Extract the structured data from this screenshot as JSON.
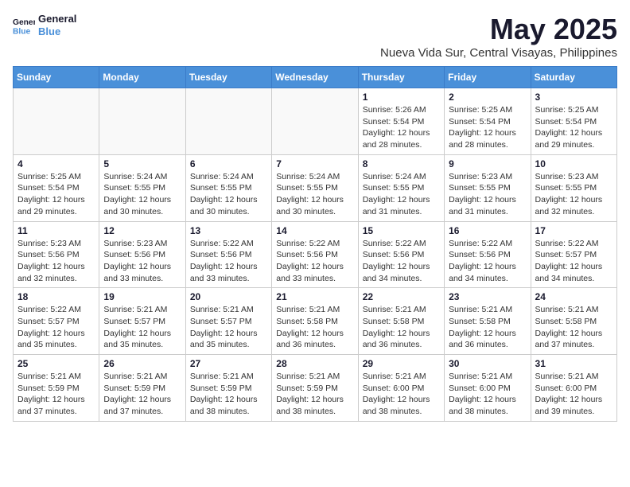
{
  "logo": {
    "line1": "General",
    "line2": "Blue"
  },
  "title": "May 2025",
  "subtitle": "Nueva Vida Sur, Central Visayas, Philippines",
  "weekdays": [
    "Sunday",
    "Monday",
    "Tuesday",
    "Wednesday",
    "Thursday",
    "Friday",
    "Saturday"
  ],
  "weeks": [
    [
      {
        "day": "",
        "info": ""
      },
      {
        "day": "",
        "info": ""
      },
      {
        "day": "",
        "info": ""
      },
      {
        "day": "",
        "info": ""
      },
      {
        "day": "1",
        "info": "Sunrise: 5:26 AM\nSunset: 5:54 PM\nDaylight: 12 hours\nand 28 minutes."
      },
      {
        "day": "2",
        "info": "Sunrise: 5:25 AM\nSunset: 5:54 PM\nDaylight: 12 hours\nand 28 minutes."
      },
      {
        "day": "3",
        "info": "Sunrise: 5:25 AM\nSunset: 5:54 PM\nDaylight: 12 hours\nand 29 minutes."
      }
    ],
    [
      {
        "day": "4",
        "info": "Sunrise: 5:25 AM\nSunset: 5:54 PM\nDaylight: 12 hours\nand 29 minutes."
      },
      {
        "day": "5",
        "info": "Sunrise: 5:24 AM\nSunset: 5:55 PM\nDaylight: 12 hours\nand 30 minutes."
      },
      {
        "day": "6",
        "info": "Sunrise: 5:24 AM\nSunset: 5:55 PM\nDaylight: 12 hours\nand 30 minutes."
      },
      {
        "day": "7",
        "info": "Sunrise: 5:24 AM\nSunset: 5:55 PM\nDaylight: 12 hours\nand 30 minutes."
      },
      {
        "day": "8",
        "info": "Sunrise: 5:24 AM\nSunset: 5:55 PM\nDaylight: 12 hours\nand 31 minutes."
      },
      {
        "day": "9",
        "info": "Sunrise: 5:23 AM\nSunset: 5:55 PM\nDaylight: 12 hours\nand 31 minutes."
      },
      {
        "day": "10",
        "info": "Sunrise: 5:23 AM\nSunset: 5:55 PM\nDaylight: 12 hours\nand 32 minutes."
      }
    ],
    [
      {
        "day": "11",
        "info": "Sunrise: 5:23 AM\nSunset: 5:56 PM\nDaylight: 12 hours\nand 32 minutes."
      },
      {
        "day": "12",
        "info": "Sunrise: 5:23 AM\nSunset: 5:56 PM\nDaylight: 12 hours\nand 33 minutes."
      },
      {
        "day": "13",
        "info": "Sunrise: 5:22 AM\nSunset: 5:56 PM\nDaylight: 12 hours\nand 33 minutes."
      },
      {
        "day": "14",
        "info": "Sunrise: 5:22 AM\nSunset: 5:56 PM\nDaylight: 12 hours\nand 33 minutes."
      },
      {
        "day": "15",
        "info": "Sunrise: 5:22 AM\nSunset: 5:56 PM\nDaylight: 12 hours\nand 34 minutes."
      },
      {
        "day": "16",
        "info": "Sunrise: 5:22 AM\nSunset: 5:56 PM\nDaylight: 12 hours\nand 34 minutes."
      },
      {
        "day": "17",
        "info": "Sunrise: 5:22 AM\nSunset: 5:57 PM\nDaylight: 12 hours\nand 34 minutes."
      }
    ],
    [
      {
        "day": "18",
        "info": "Sunrise: 5:22 AM\nSunset: 5:57 PM\nDaylight: 12 hours\nand 35 minutes."
      },
      {
        "day": "19",
        "info": "Sunrise: 5:21 AM\nSunset: 5:57 PM\nDaylight: 12 hours\nand 35 minutes."
      },
      {
        "day": "20",
        "info": "Sunrise: 5:21 AM\nSunset: 5:57 PM\nDaylight: 12 hours\nand 35 minutes."
      },
      {
        "day": "21",
        "info": "Sunrise: 5:21 AM\nSunset: 5:58 PM\nDaylight: 12 hours\nand 36 minutes."
      },
      {
        "day": "22",
        "info": "Sunrise: 5:21 AM\nSunset: 5:58 PM\nDaylight: 12 hours\nand 36 minutes."
      },
      {
        "day": "23",
        "info": "Sunrise: 5:21 AM\nSunset: 5:58 PM\nDaylight: 12 hours\nand 36 minutes."
      },
      {
        "day": "24",
        "info": "Sunrise: 5:21 AM\nSunset: 5:58 PM\nDaylight: 12 hours\nand 37 minutes."
      }
    ],
    [
      {
        "day": "25",
        "info": "Sunrise: 5:21 AM\nSunset: 5:59 PM\nDaylight: 12 hours\nand 37 minutes."
      },
      {
        "day": "26",
        "info": "Sunrise: 5:21 AM\nSunset: 5:59 PM\nDaylight: 12 hours\nand 37 minutes."
      },
      {
        "day": "27",
        "info": "Sunrise: 5:21 AM\nSunset: 5:59 PM\nDaylight: 12 hours\nand 38 minutes."
      },
      {
        "day": "28",
        "info": "Sunrise: 5:21 AM\nSunset: 5:59 PM\nDaylight: 12 hours\nand 38 minutes."
      },
      {
        "day": "29",
        "info": "Sunrise: 5:21 AM\nSunset: 6:00 PM\nDaylight: 12 hours\nand 38 minutes."
      },
      {
        "day": "30",
        "info": "Sunrise: 5:21 AM\nSunset: 6:00 PM\nDaylight: 12 hours\nand 38 minutes."
      },
      {
        "day": "31",
        "info": "Sunrise: 5:21 AM\nSunset: 6:00 PM\nDaylight: 12 hours\nand 39 minutes."
      }
    ]
  ]
}
